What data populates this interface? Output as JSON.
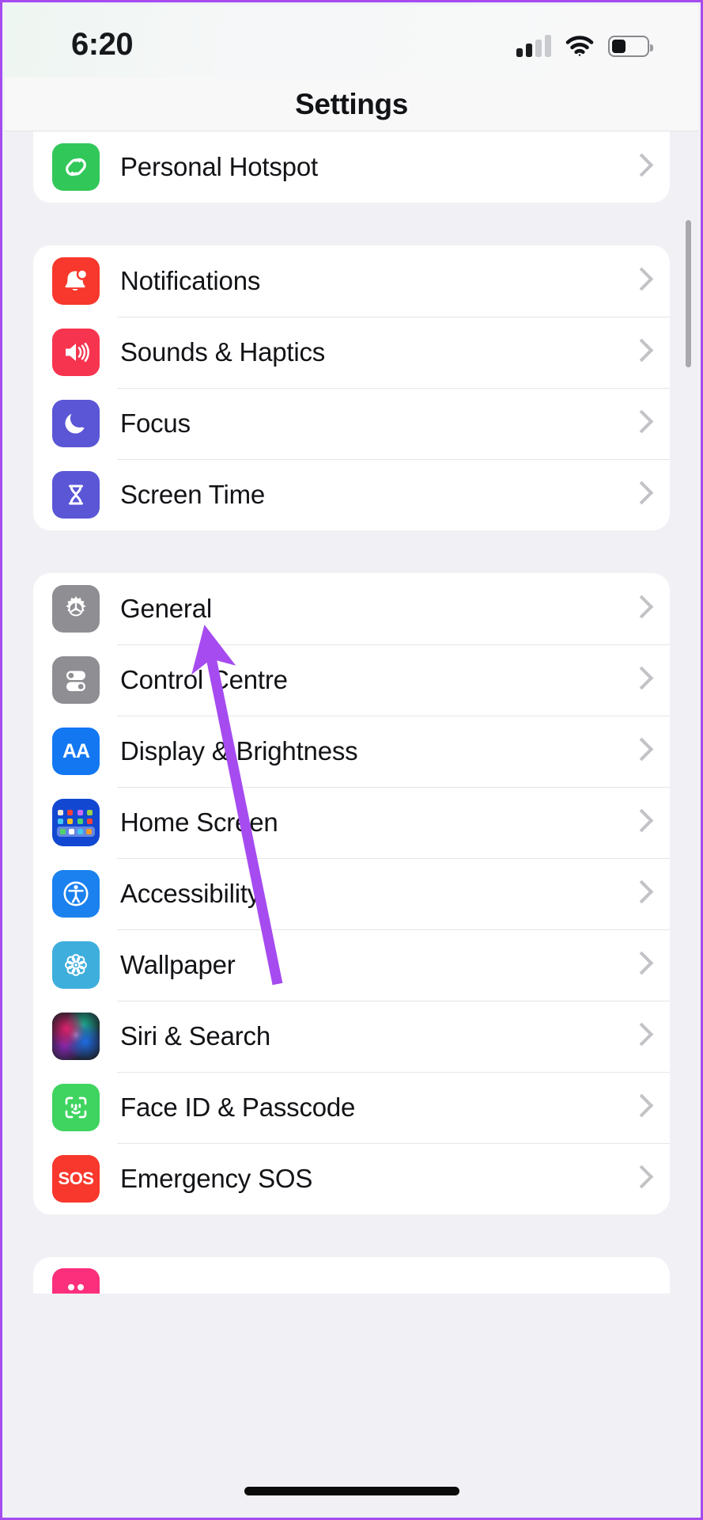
{
  "status_bar": {
    "time": "6:20",
    "cellular_icon": "cellular-signal-icon",
    "cellular_bars_filled": 2,
    "cellular_bars_total": 4,
    "wifi_icon": "wifi-icon",
    "battery_icon": "battery-icon",
    "battery_level_percent": 35
  },
  "nav": {
    "title": "Settings"
  },
  "groups": [
    {
      "id": "group-connectivity",
      "rows": [
        {
          "label": "Personal Hotspot",
          "icon": "personal-hotspot-icon",
          "icon_color": "#32c759",
          "chevron": "chevron-right-icon"
        }
      ]
    },
    {
      "id": "group-alerts",
      "rows": [
        {
          "label": "Notifications",
          "icon": "notifications-bell-icon",
          "icon_color": "#f8382c",
          "chevron": "chevron-right-icon"
        },
        {
          "label": "Sounds & Haptics",
          "icon": "sounds-speaker-icon",
          "icon_color": "#f6344f",
          "chevron": "chevron-right-icon"
        },
        {
          "label": "Focus",
          "icon": "focus-moon-icon",
          "icon_color": "#5a56d6",
          "chevron": "chevron-right-icon"
        },
        {
          "label": "Screen Time",
          "icon": "screen-time-hourglass-icon",
          "icon_color": "#5a56d6",
          "chevron": "chevron-right-icon"
        }
      ]
    },
    {
      "id": "group-system",
      "rows": [
        {
          "label": "General",
          "icon": "general-gear-icon",
          "icon_color": "#8e8e93",
          "chevron": "chevron-right-icon"
        },
        {
          "label": "Control Centre",
          "icon": "control-centre-toggles-icon",
          "icon_color": "#8e8e93",
          "chevron": "chevron-right-icon"
        },
        {
          "label": "Display & Brightness",
          "icon": "display-brightness-aa-icon",
          "icon_color": "#1377f2",
          "icon_text": "AA",
          "chevron": "chevron-right-icon"
        },
        {
          "label": "Home Screen",
          "icon": "home-screen-grid-icon",
          "icon_color": "#1248d1",
          "chevron": "chevron-right-icon"
        },
        {
          "label": "Accessibility",
          "icon": "accessibility-person-icon",
          "icon_color": "#1a81ef",
          "chevron": "chevron-right-icon"
        },
        {
          "label": "Wallpaper",
          "icon": "wallpaper-flower-icon",
          "icon_color": "#3eaedd",
          "chevron": "chevron-right-icon"
        },
        {
          "label": "Siri & Search",
          "icon": "siri-orb-icon",
          "icon_color": "#2a2a33",
          "chevron": "chevron-right-icon"
        },
        {
          "label": "Face ID & Passcode",
          "icon": "face-id-icon",
          "icon_color": "#3ed45f",
          "chevron": "chevron-right-icon"
        },
        {
          "label": "Emergency SOS",
          "icon": "emergency-sos-icon",
          "icon_color": "#f8382c",
          "icon_text": "SOS",
          "chevron": "chevron-right-icon"
        }
      ]
    }
  ],
  "partial_row": {
    "icon": "exposure-notifications-icon",
    "icon_color": "#fb2f7c"
  },
  "annotation": {
    "arrow_icon": "annotation-arrow-icon",
    "arrow_color": "#a64bf0",
    "points_at": "General",
    "frame_color": "#a64bf0"
  },
  "scrollbar": {
    "name": "vertical-scrollbar"
  },
  "home_indicator": {
    "name": "home-indicator"
  }
}
